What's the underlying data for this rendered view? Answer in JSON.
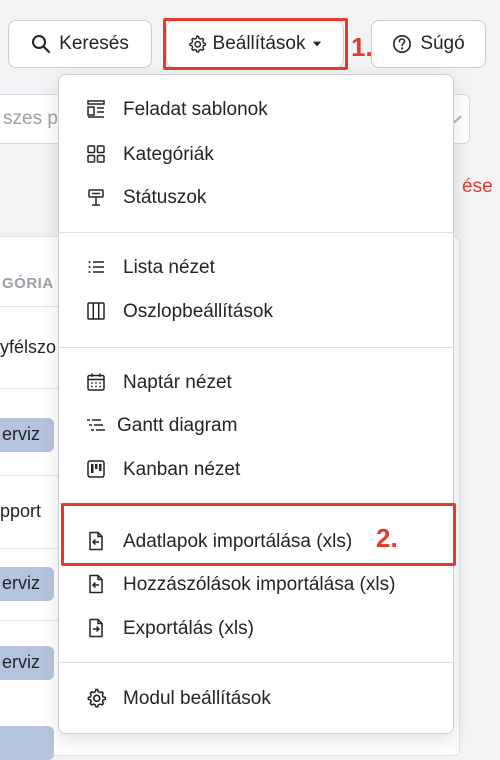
{
  "toolbar": {
    "search_label": "Keresés",
    "settings_label": "Beállítások",
    "help_label": "Súgó"
  },
  "annotations": {
    "step1": "1.",
    "step2": "2."
  },
  "background": {
    "search_placeholder": "szes p",
    "red_text": "ése",
    "column_header": "GÓRIA",
    "rows": [
      "yfélszo",
      "erviz",
      "pport",
      "erviz",
      "erviz"
    ]
  },
  "menu": {
    "group1": [
      "Feladat sablonok",
      "Kategóriák",
      "Státuszok"
    ],
    "group2": [
      "Lista nézet",
      "Oszlopbeállítások"
    ],
    "group3": [
      "Naptár nézet",
      "Gantt diagram",
      "Kanban nézet"
    ],
    "group4": [
      "Adatlapok importálása (xls)",
      "Hozzászólások importálása (xls)",
      "Exportálás (xls)"
    ],
    "group5": [
      "Modul beállítások"
    ]
  },
  "colors": {
    "highlight": "#e43a2b",
    "badge": "#b5c4dd"
  }
}
